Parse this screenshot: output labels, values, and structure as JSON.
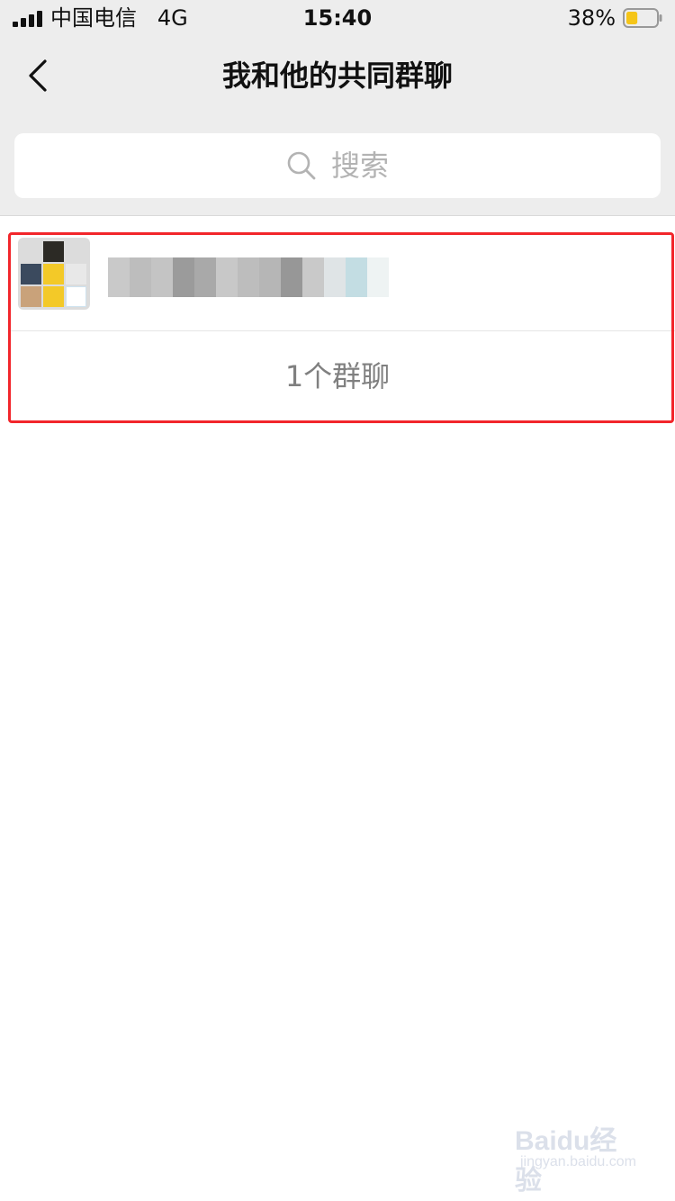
{
  "status_bar": {
    "carrier": "中国电信   4G",
    "time": "15:40",
    "battery_percent": "38%",
    "battery_level": 0.38
  },
  "nav": {
    "back_icon": "chevron-left-icon",
    "title": "我和他的共同群聊"
  },
  "search": {
    "icon": "search-icon",
    "placeholder": "搜索"
  },
  "groups": [
    {
      "avatar_icon": "group-avatar-grid",
      "name_blurred": true
    }
  ],
  "summary": {
    "count_label": "1个群聊"
  },
  "watermark": {
    "logo": "Baidu经验",
    "url": "jingyan.baidu.com"
  },
  "colors": {
    "header_bg": "#ededed",
    "highlight_border": "#f2262b",
    "battery_fill": "#f5c518"
  }
}
